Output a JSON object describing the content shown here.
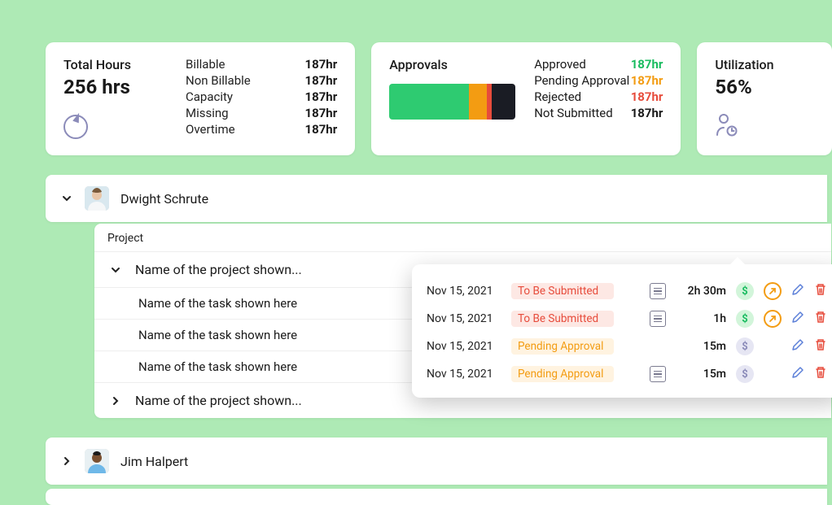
{
  "total_hours": {
    "title": "Total Hours",
    "value": "256 hrs",
    "rows": [
      {
        "k": "Billable",
        "v": "187hr"
      },
      {
        "k": "Non Billable",
        "v": "187hr"
      },
      {
        "k": "Capacity",
        "v": "187hr"
      },
      {
        "k": "Missing",
        "v": "187hr"
      },
      {
        "k": "Overtime",
        "v": "187hr"
      }
    ]
  },
  "approvals": {
    "title": "Approvals",
    "rows": [
      {
        "k": "Approved",
        "v": "187hr",
        "cls": "c-approved"
      },
      {
        "k": "Pending Approval",
        "v": "187hr",
        "cls": "c-pending"
      },
      {
        "k": "Rejected",
        "v": "187hr",
        "cls": "c-rejected"
      },
      {
        "k": "Not Submitted",
        "v": "187hr",
        "cls": ""
      }
    ]
  },
  "utilization": {
    "title": "Utilization",
    "value": "56%"
  },
  "users": [
    {
      "name": "Dwight Schrute",
      "expanded": true,
      "avatar": "dwight"
    },
    {
      "name": "Jim Halpert",
      "expanded": false,
      "avatar": "jim"
    }
  ],
  "projects": {
    "header": "Project",
    "items": [
      {
        "name": "Name of the project shown...",
        "expanded": true,
        "tasks": [
          "Name of the task shown here",
          "Name of the task shown here",
          "Name of the task shown here"
        ]
      },
      {
        "name": "Name of the project shown...",
        "expanded": false,
        "tasks": []
      }
    ]
  },
  "entries": [
    {
      "date": "Nov 15, 2021",
      "status": "To Be Submitted",
      "status_cls": "status-tbs",
      "time": "2h 30m",
      "billable": true,
      "arrow": true
    },
    {
      "date": "Nov 15, 2021",
      "status": "To Be Submitted",
      "status_cls": "status-tbs",
      "time": "1h",
      "billable": true,
      "arrow": true
    },
    {
      "date": "Nov 15, 2021",
      "status": "Pending Approval",
      "status_cls": "status-pa",
      "time": "15m",
      "billable": false,
      "arrow": false
    },
    {
      "date": "Nov 15, 2021",
      "status": "Pending Approval",
      "status_cls": "status-pa",
      "time": "15m",
      "billable": false,
      "arrow": false
    }
  ]
}
